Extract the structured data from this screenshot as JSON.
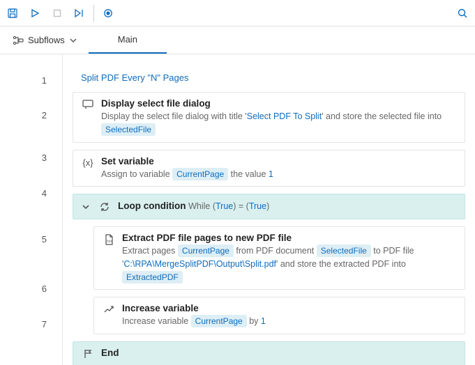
{
  "toolbar": {
    "save": "Save",
    "run": "Run",
    "stop": "Stop",
    "step": "Step",
    "record": "Record",
    "search": "Search"
  },
  "tabs": {
    "subflows_label": "Subflows",
    "main_label": "Main"
  },
  "lines": [
    "1",
    "2",
    "3",
    "4",
    "5",
    "6",
    "7"
  ],
  "s1": {
    "title": "Split PDF Every \"N\" Pages"
  },
  "s2": {
    "title": "Display select file dialog",
    "d1": "Display the select file dialog with title '",
    "d2": "Select PDF To Split",
    "d3": "' and store the selected file into ",
    "chip": "SelectedFile"
  },
  "s3": {
    "title": "Set variable",
    "d1": "Assign to variable ",
    "chip": "CurrentPage",
    "d2": " the value ",
    "val": "1"
  },
  "s4": {
    "title": "Loop condition",
    "d1": " While (",
    "v1": "True",
    "d2": ") = (",
    "v2": "True",
    "d3": ")"
  },
  "s5": {
    "title": "Extract PDF file pages to new PDF file",
    "d1": "Extract pages ",
    "chip1": "CurrentPage",
    "d2": " from PDF document ",
    "chip2": "SelectedFile",
    "d3": " to PDF file '",
    "path": "C:\\RPA\\MergeSplitPDF\\Output\\Split.pdf",
    "d4": "' and store the extracted PDF into ",
    "chip3": "ExtractedPDF"
  },
  "s6": {
    "title": "Increase variable",
    "d1": "Increase variable ",
    "chip": "CurrentPage",
    "d2": " by ",
    "val": "1"
  },
  "s7": {
    "title": "End"
  }
}
